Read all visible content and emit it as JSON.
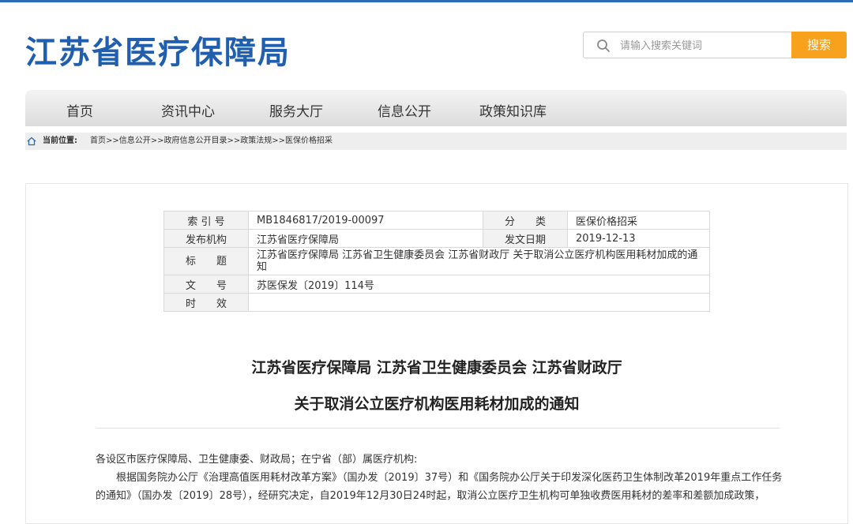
{
  "site": {
    "logo": "江苏省医疗保障局"
  },
  "search": {
    "placeholder": "请输入搜索关键词",
    "button": "搜索"
  },
  "nav": {
    "items": [
      "首页",
      "资讯中心",
      "服务大厅",
      "信息公开",
      "政策知识库"
    ]
  },
  "breadcrumb": {
    "label": "当前位置:",
    "path": "首页>>信息公开>>政府信息公开目录>>政策法规>>医保价格招采"
  },
  "meta": {
    "index_label": "索 引 号",
    "index_value": "MB1846817/2019-00097",
    "category_label": "分　　类",
    "category_value": "医保价格招采",
    "publisher_label": "发布机构",
    "publisher_value": "江苏省医疗保障局",
    "date_label": "发文日期",
    "date_value": "2019-12-13",
    "title_label": "标　　题",
    "title_value": "江苏省医疗保障局 江苏省卫生健康委员会 江苏省财政厅 关于取消公立医疗机构医用耗材加成的通知",
    "docno_label": "文　　号",
    "docno_value": "苏医保发〔2019〕114号",
    "validity_label": "时　　效",
    "validity_value": ""
  },
  "article": {
    "title_line1": "江苏省医疗保障局 江苏省卫生健康委员会 江苏省财政厅",
    "title_line2": "关于取消公立医疗机构医用耗材加成的通知",
    "greeting": "各设区市医疗保障局、卫生健康委、财政局；在宁省（部）属医疗机构:",
    "para1": "根据国务院办公厅《治理高值医用耗材改革方案》（国办发〔2019〕37号）和《国务院办公厅关于印发深化医药卫生体制改革2019年重点工作任务的通知》（国办发〔2019〕28号），经研究决定，自2019年12月30日24时起，取消公立医疗卫生机构可单独收费医用耗材的差率和差额加成政策，"
  }
}
